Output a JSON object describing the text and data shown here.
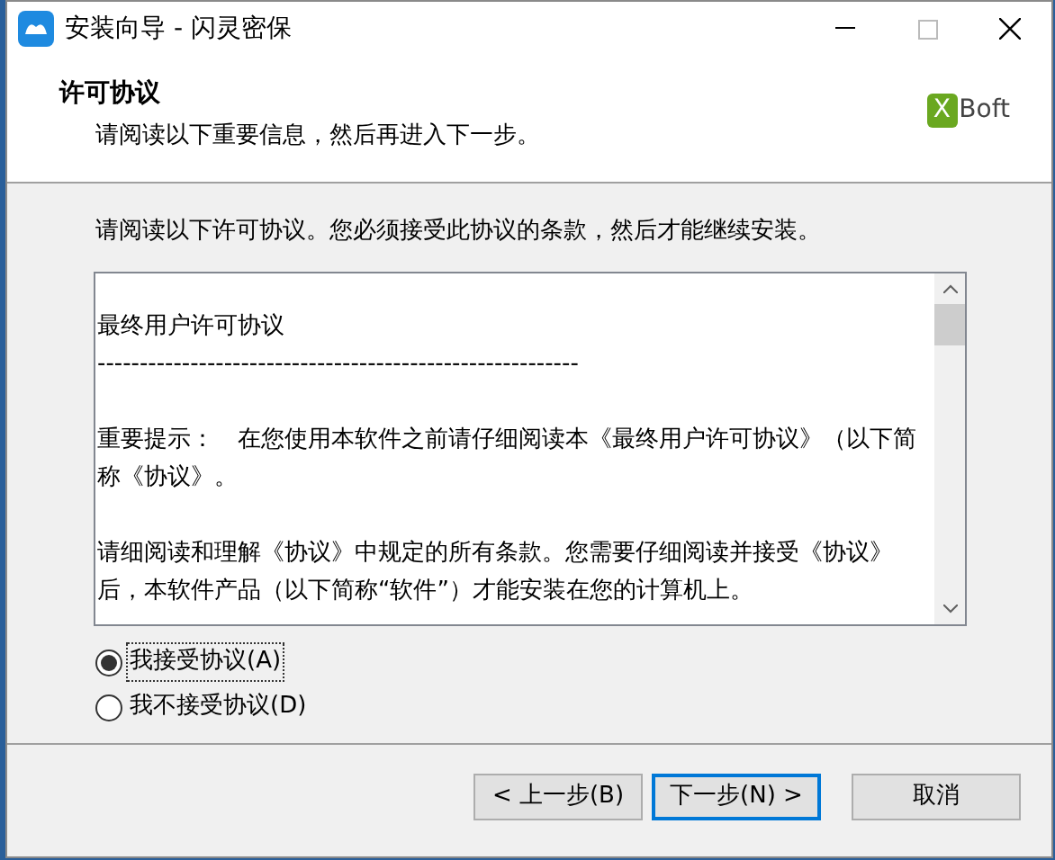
{
  "window": {
    "title": "安装向导 - 闪灵密保"
  },
  "header": {
    "title": "许可协议",
    "subtitle": "请阅读以下重要信息，然后再进入下一步。",
    "logo": {
      "mark": "X",
      "text": "Boft"
    }
  },
  "instruction": "请阅读以下许可协议。您必须接受此协议的条款，然后才能继续安装。",
  "license_text": [
    "最终用户许可协议",
    "---------------------------------------------------------",
    "重要提示：　在您使用本软件之前请仔细阅读本《最终用户许可协议》（以下简称《协议》。",
    "请细阅读和理解《协议》中规定的所有条款。您需要仔细阅读并接受《协议》后，本软件产品（以下简称“软件”）才能安装在您的计算机上。"
  ],
  "options": [
    {
      "label": "我接受协议(A)",
      "selected": true
    },
    {
      "label": "我不接受协议(D)",
      "selected": false
    }
  ],
  "buttons": [
    {
      "label": "< 上一步(B)",
      "default": false
    },
    {
      "label": "下一步(N) >",
      "default": true
    },
    {
      "label": "取消",
      "default": false
    }
  ]
}
